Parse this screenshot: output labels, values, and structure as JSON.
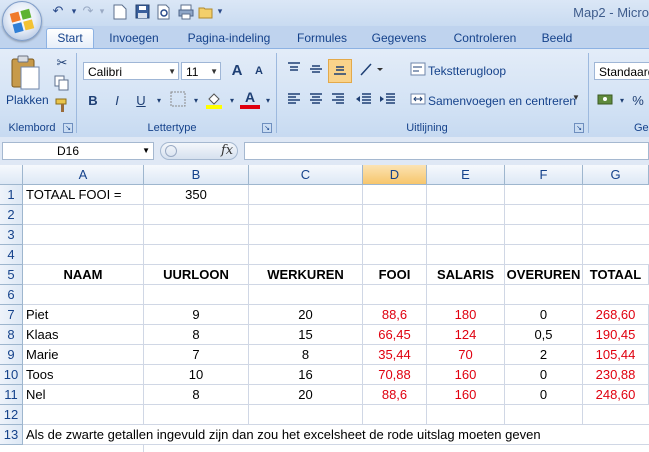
{
  "window": {
    "title": "Map2 - Micro"
  },
  "tabs": [
    "Start",
    "Invoegen",
    "Pagina-indeling",
    "Formules",
    "Gegevens",
    "Controleren",
    "Beeld"
  ],
  "ribbon": {
    "clipboard": {
      "paste_label": "Plakken",
      "group_label": "Klembord"
    },
    "font": {
      "name": "Calibri",
      "size": "11",
      "bold": "B",
      "italic": "I",
      "underline": "U",
      "grow": "A",
      "shrink": "A",
      "font_color": "A",
      "group_label": "Lettertype"
    },
    "alignment": {
      "wrap_label": "Tekstterugloop",
      "merge_label": "Samenvoegen en centreren",
      "group_label": "Uitlijning"
    },
    "number": {
      "format": "Standaard",
      "percent": "%",
      "group_label": "Ge"
    }
  },
  "formula_bar": {
    "name_box": "D16",
    "fx": "fx",
    "formula": ""
  },
  "columns": [
    "A",
    "B",
    "C",
    "D",
    "E",
    "F",
    "G"
  ],
  "rows": [
    "1",
    "2",
    "3",
    "4",
    "5",
    "6",
    "7",
    "8",
    "9",
    "10",
    "11",
    "12",
    "13"
  ],
  "cells": {
    "r1": {
      "A": "TOTAAL FOOI =",
      "B": "350"
    },
    "headers": {
      "A": "NAAM",
      "B": "UURLOON",
      "C": "WERKUREN",
      "D": "FOOI",
      "E": "SALARIS",
      "F": "OVERUREN",
      "G": "TOTAAL"
    },
    "data": [
      {
        "name": "Piet",
        "uurloon": "9",
        "werkuren": "20",
        "fooi": "88,6",
        "salaris": "180",
        "overuren": "0",
        "totaal": "268,60"
      },
      {
        "name": "Klaas",
        "uurloon": "8",
        "werkuren": "15",
        "fooi": "66,45",
        "salaris": "124",
        "overuren": "0,5",
        "totaal": "190,45"
      },
      {
        "name": "Marie",
        "uurloon": "7",
        "werkuren": "8",
        "fooi": "35,44",
        "salaris": "70",
        "overuren": "2",
        "totaal": "105,44"
      },
      {
        "name": "Toos",
        "uurloon": "10",
        "werkuren": "16",
        "fooi": "70,88",
        "salaris": "160",
        "overuren": "0",
        "totaal": "230,88"
      },
      {
        "name": "Nel",
        "uurloon": "8",
        "werkuren": "20",
        "fooi": "88,6",
        "salaris": "160",
        "overuren": "0",
        "totaal": "248,60"
      }
    ],
    "r13": "Als de zwarte getallen ingevuld zijn dan zou het excelsheet de rode uitslag moeten geven"
  },
  "colors": {
    "result_red": "#e0000f",
    "header_blue": "#15428b",
    "selected_col": "#f7c66c"
  }
}
